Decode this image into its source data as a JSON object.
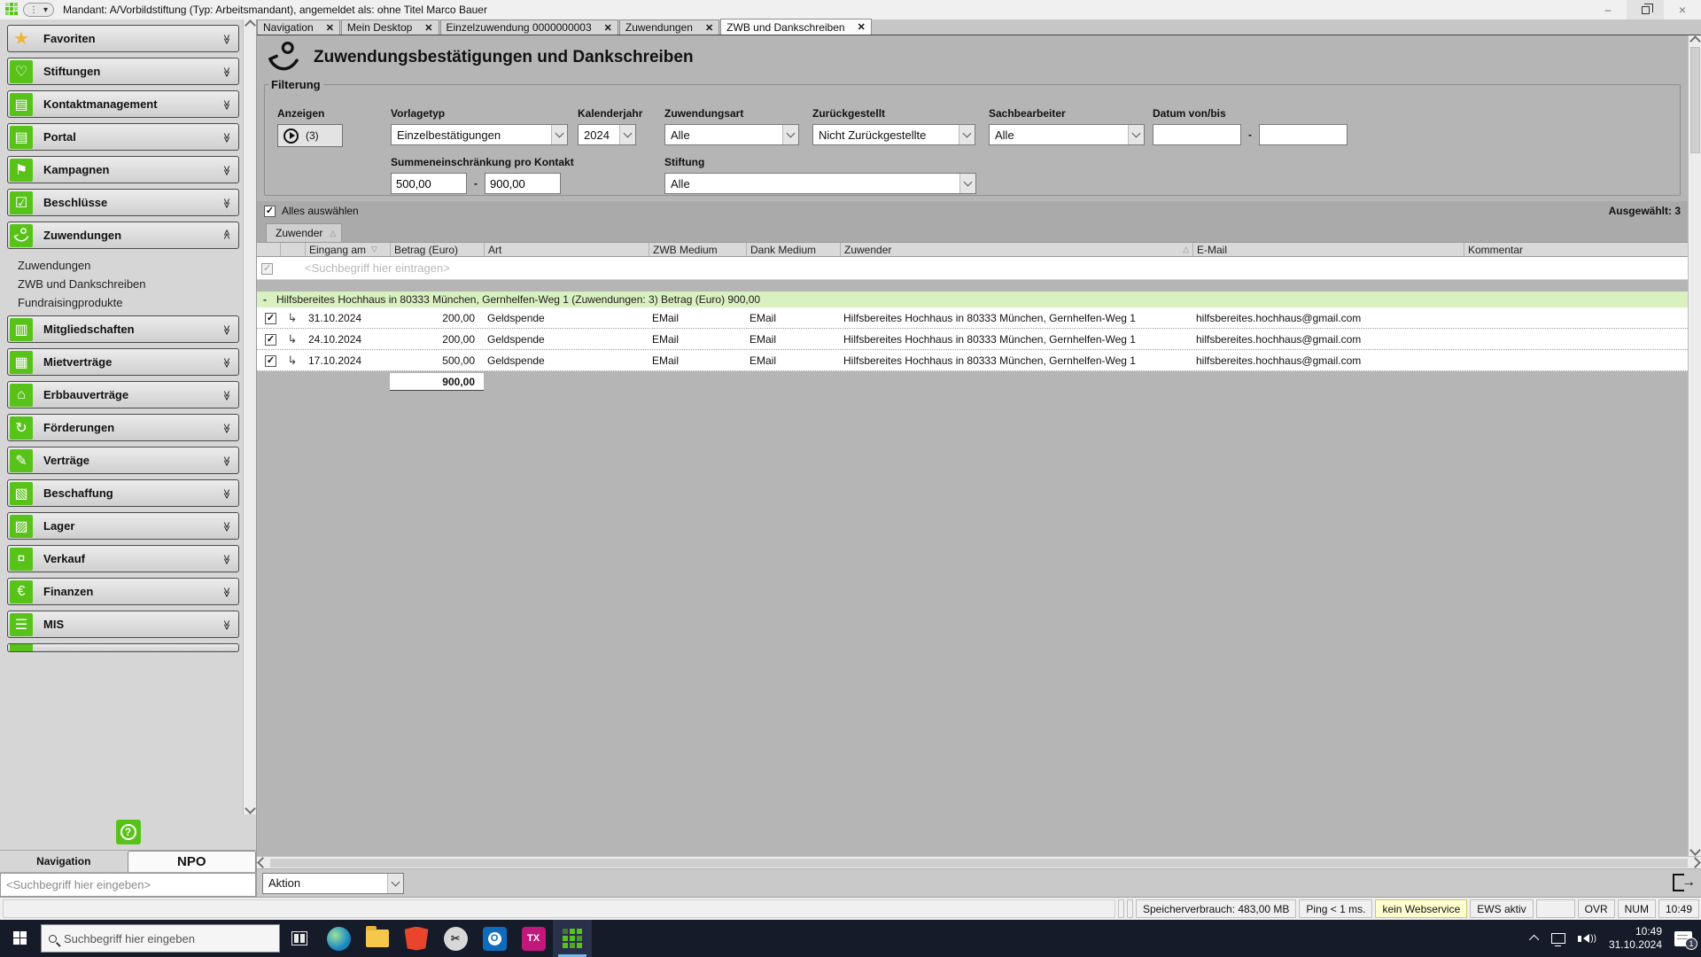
{
  "titlebar": {
    "title": "Mandant: A/Vorbildstiftung (Typ: Arbeitsmandant), angemeldet als: ohne Titel Marco Bauer"
  },
  "tabs": [
    {
      "label": "Navigation"
    },
    {
      "label": "Mein Desktop"
    },
    {
      "label": "Einzelzuwendung 0000000003"
    },
    {
      "label": "Zuwendungen"
    },
    {
      "label": "ZWB und Dankschreiben"
    }
  ],
  "page": {
    "title": "Zuwendungsbestätigungen und Dankschreiben"
  },
  "sidebar": {
    "items": [
      {
        "label": "Favoriten"
      },
      {
        "label": "Stiftungen"
      },
      {
        "label": "Kontaktmanagement"
      },
      {
        "label": "Portal"
      },
      {
        "label": "Kampagnen"
      },
      {
        "label": "Beschlüsse"
      },
      {
        "label": "Zuwendungen"
      },
      {
        "label": "Mitgliedschaften"
      },
      {
        "label": "Mietverträge"
      },
      {
        "label": "Erbbauverträge"
      },
      {
        "label": "Förderungen"
      },
      {
        "label": "Verträge"
      },
      {
        "label": "Beschaffung"
      },
      {
        "label": "Lager"
      },
      {
        "label": "Verkauf"
      },
      {
        "label": "Finanzen"
      },
      {
        "label": "MIS"
      }
    ],
    "sub_items": [
      "Zuwendungen",
      "ZWB und Dankschreiben",
      "Fundraisingprodukte"
    ],
    "bottom_tabs": [
      "Navigation",
      "NPO"
    ],
    "search_placeholder": "<Suchbegriff hier eingeben>"
  },
  "filter": {
    "legend": "Filterung",
    "anzeigen": {
      "label": "Anzeigen",
      "count": "(3)"
    },
    "vorlagetyp": {
      "label": "Vorlagetyp",
      "value": "Einzelbestätigungen"
    },
    "kalenderjahr": {
      "label": "Kalenderjahr",
      "value": "2024"
    },
    "zuwendungsart": {
      "label": "Zuwendungsart",
      "value": "Alle"
    },
    "zurueckgestellt": {
      "label": "Zurückgestellt",
      "value": "Nicht Zurückgestellte"
    },
    "sachbearbeiter": {
      "label": "Sachbearbeiter",
      "value": "Alle"
    },
    "datum": {
      "label": "Datum von/bis",
      "von": "",
      "bis": "",
      "separator": "-"
    },
    "summe": {
      "label": "Summeneinschränkung pro Kontakt",
      "von": "500,00",
      "bis": "900,00",
      "separator": "-"
    },
    "stiftung": {
      "label": "Stiftung",
      "value": "Alle"
    }
  },
  "list": {
    "select_all": "Alles auswählen",
    "selected": "Ausgewählt: 3",
    "group_chip": "Zuwender",
    "columns": {
      "eingang": "Eingang am",
      "betrag": "Betrag (Euro)",
      "art": "Art",
      "zwb": "ZWB Medium",
      "dank": "Dank Medium",
      "zuwender": "Zuwender",
      "email": "E-Mail",
      "kommentar": "Kommentar"
    },
    "search_placeholder": "<Suchbegriff hier eintragen>",
    "group_header": "Hilfsbereites Hochhaus in 80333 München, Gernhelfen-Weg 1 (Zuwendungen: 3) Betrag (Euro) 900,00",
    "rows": [
      {
        "date": "31.10.2024",
        "amount": "200,00",
        "art": "Geldspende",
        "zwb_medium": "EMail",
        "dank_medium": "EMail",
        "zuwender": "Hilfsbereites Hochhaus in 80333 München, Gernhelfen-Weg 1",
        "email": "hilfsbereites.hochhaus@gmail.com",
        "kommentar": ""
      },
      {
        "date": "24.10.2024",
        "amount": "200,00",
        "art": "Geldspende",
        "zwb_medium": "EMail",
        "dank_medium": "EMail",
        "zuwender": "Hilfsbereites Hochhaus in 80333 München, Gernhelfen-Weg 1",
        "email": "hilfsbereites.hochhaus@gmail.com",
        "kommentar": ""
      },
      {
        "date": "17.10.2024",
        "amount": "500,00",
        "art": "Geldspende",
        "zwb_medium": "EMail",
        "dank_medium": "EMail",
        "zuwender": "Hilfsbereites Hochhaus in 80333 München, Gernhelfen-Weg 1",
        "email": "hilfsbereites.hochhaus@gmail.com",
        "kommentar": ""
      }
    ],
    "sum": "900,00"
  },
  "action_bar": {
    "aktion": "Aktion"
  },
  "status_bar": {
    "memory": "Speicherverbrauch: 483,00 MB",
    "ping": "Ping < 1 ms.",
    "webservice": "kein Webservice",
    "ews": "EWS aktiv",
    "ovr": "OVR",
    "num": "NUM",
    "time": "10:49"
  },
  "taskbar": {
    "search_placeholder": "Suchbegriff hier eingeben",
    "clock_time": "10:49",
    "clock_date": "31.10.2024",
    "badge": "1"
  },
  "colors": {
    "accent_green": "#57c319",
    "group_row_bg": "#d9f0c1",
    "webservice_bg": "#ffffcf"
  }
}
